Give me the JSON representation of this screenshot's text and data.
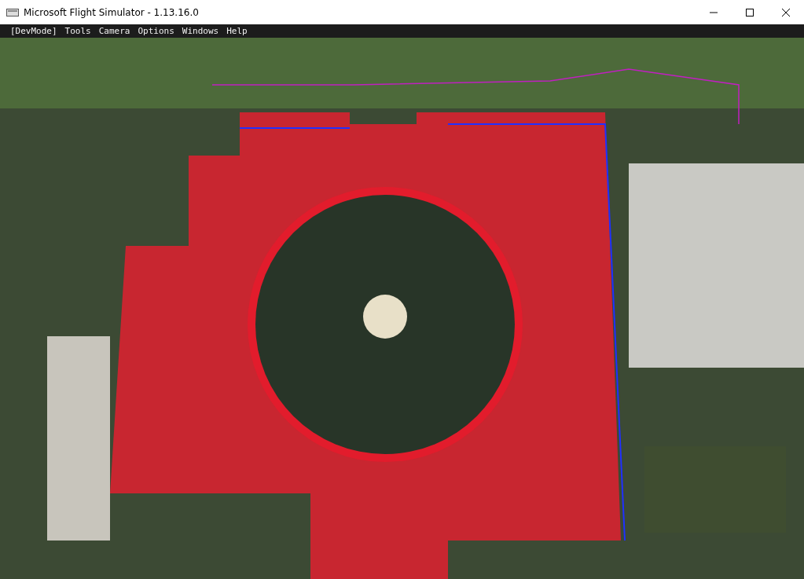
{
  "window": {
    "title": "Microsoft Flight Simulator - 1.13.16.0"
  },
  "menu": [
    {
      "label": "[DevMode]"
    },
    {
      "label": "Tools"
    },
    {
      "label": "Camera"
    },
    {
      "label": "Options"
    },
    {
      "label": "Windows"
    },
    {
      "label": "Help"
    }
  ]
}
